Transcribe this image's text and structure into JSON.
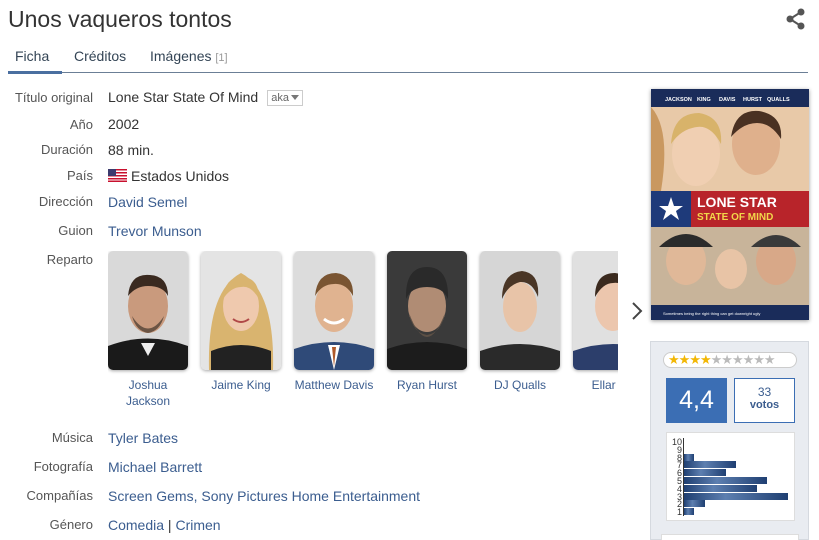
{
  "title": "Unos vaqueros tontos",
  "tabs": [
    {
      "label": "Ficha"
    },
    {
      "label": "Créditos"
    },
    {
      "label": "Imágenes",
      "count": "[1]"
    }
  ],
  "fields": {
    "original_title": {
      "label": "Título original",
      "value": "Lone Star State Of Mind",
      "aka": "aka"
    },
    "year": {
      "label": "Año",
      "value": "2002"
    },
    "duration": {
      "label": "Duración",
      "value": "88 min."
    },
    "country": {
      "label": "País",
      "value": "Estados Unidos",
      "flag_icon": "usa-flag-icon"
    },
    "director": {
      "label": "Dirección",
      "value": "David Semel"
    },
    "script": {
      "label": "Guion",
      "value": "Trevor Munson"
    },
    "cast_label": "Reparto",
    "music": {
      "label": "Música",
      "value": "Tyler Bates"
    },
    "photography": {
      "label": "Fotografía",
      "value": "Michael Barrett"
    },
    "companies": {
      "label": "Compañías",
      "value": "Screen Gems, Sony Pictures Home Entertainment"
    },
    "genre": {
      "label": "Género",
      "values": [
        "Comedia",
        "Crimen"
      ],
      "separator": "|"
    }
  },
  "cast": [
    {
      "name": "Joshua Jackson"
    },
    {
      "name": "Jaime King"
    },
    {
      "name": "Matthew Davis"
    },
    {
      "name": "Ryan Hurst"
    },
    {
      "name": "DJ Qualls"
    },
    {
      "name": "Ellar Co"
    }
  ],
  "poster": {
    "credits": [
      "JACKSON",
      "KING",
      "DAVIS",
      "HURST",
      "QUALLS"
    ],
    "title_line1": "LONE STAR",
    "title_line2": "STATE OF MIND",
    "tagline": "Sometimes being the right thing can get downright ugly"
  },
  "rating": {
    "stars_filled": 4,
    "stars_total": 10,
    "average": "4,4",
    "votes_count": "33",
    "votes_label": "votos",
    "histogram_labels": [
      "10",
      "9",
      "8",
      "7",
      "6",
      "5",
      "4",
      "3",
      "2",
      "1"
    ],
    "histogram": [
      0,
      0,
      1,
      5,
      4,
      8,
      7,
      10,
      2,
      1
    ]
  },
  "colors": {
    "link": "#3b5d8f",
    "accent": "#3b6eb4",
    "star": "#f2b705"
  }
}
